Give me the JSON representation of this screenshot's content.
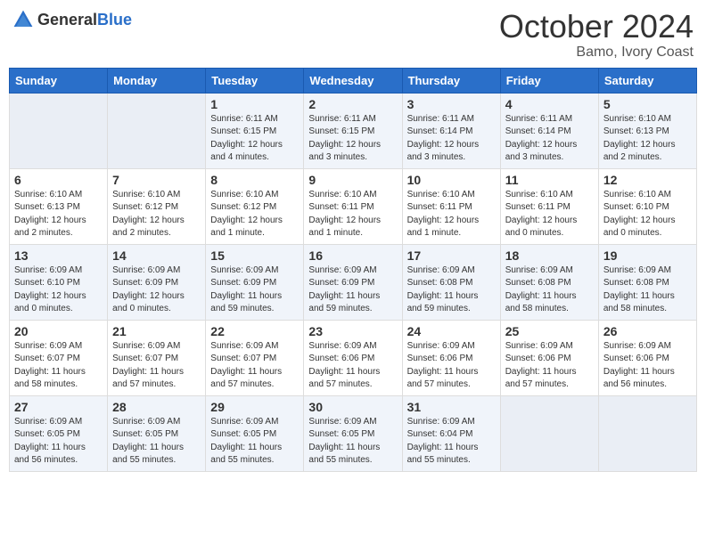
{
  "header": {
    "logo_general": "General",
    "logo_blue": "Blue",
    "month": "October 2024",
    "location": "Bamo, Ivory Coast"
  },
  "weekdays": [
    "Sunday",
    "Monday",
    "Tuesday",
    "Wednesday",
    "Thursday",
    "Friday",
    "Saturday"
  ],
  "weeks": [
    [
      {
        "day": "",
        "info": ""
      },
      {
        "day": "",
        "info": ""
      },
      {
        "day": "1",
        "info": "Sunrise: 6:11 AM\nSunset: 6:15 PM\nDaylight: 12 hours and 4 minutes."
      },
      {
        "day": "2",
        "info": "Sunrise: 6:11 AM\nSunset: 6:15 PM\nDaylight: 12 hours and 3 minutes."
      },
      {
        "day": "3",
        "info": "Sunrise: 6:11 AM\nSunset: 6:14 PM\nDaylight: 12 hours and 3 minutes."
      },
      {
        "day": "4",
        "info": "Sunrise: 6:11 AM\nSunset: 6:14 PM\nDaylight: 12 hours and 3 minutes."
      },
      {
        "day": "5",
        "info": "Sunrise: 6:10 AM\nSunset: 6:13 PM\nDaylight: 12 hours and 2 minutes."
      }
    ],
    [
      {
        "day": "6",
        "info": "Sunrise: 6:10 AM\nSunset: 6:13 PM\nDaylight: 12 hours and 2 minutes."
      },
      {
        "day": "7",
        "info": "Sunrise: 6:10 AM\nSunset: 6:12 PM\nDaylight: 12 hours and 2 minutes."
      },
      {
        "day": "8",
        "info": "Sunrise: 6:10 AM\nSunset: 6:12 PM\nDaylight: 12 hours and 1 minute."
      },
      {
        "day": "9",
        "info": "Sunrise: 6:10 AM\nSunset: 6:11 PM\nDaylight: 12 hours and 1 minute."
      },
      {
        "day": "10",
        "info": "Sunrise: 6:10 AM\nSunset: 6:11 PM\nDaylight: 12 hours and 1 minute."
      },
      {
        "day": "11",
        "info": "Sunrise: 6:10 AM\nSunset: 6:11 PM\nDaylight: 12 hours and 0 minutes."
      },
      {
        "day": "12",
        "info": "Sunrise: 6:10 AM\nSunset: 6:10 PM\nDaylight: 12 hours and 0 minutes."
      }
    ],
    [
      {
        "day": "13",
        "info": "Sunrise: 6:09 AM\nSunset: 6:10 PM\nDaylight: 12 hours and 0 minutes."
      },
      {
        "day": "14",
        "info": "Sunrise: 6:09 AM\nSunset: 6:09 PM\nDaylight: 12 hours and 0 minutes."
      },
      {
        "day": "15",
        "info": "Sunrise: 6:09 AM\nSunset: 6:09 PM\nDaylight: 11 hours and 59 minutes."
      },
      {
        "day": "16",
        "info": "Sunrise: 6:09 AM\nSunset: 6:09 PM\nDaylight: 11 hours and 59 minutes."
      },
      {
        "day": "17",
        "info": "Sunrise: 6:09 AM\nSunset: 6:08 PM\nDaylight: 11 hours and 59 minutes."
      },
      {
        "day": "18",
        "info": "Sunrise: 6:09 AM\nSunset: 6:08 PM\nDaylight: 11 hours and 58 minutes."
      },
      {
        "day": "19",
        "info": "Sunrise: 6:09 AM\nSunset: 6:08 PM\nDaylight: 11 hours and 58 minutes."
      }
    ],
    [
      {
        "day": "20",
        "info": "Sunrise: 6:09 AM\nSunset: 6:07 PM\nDaylight: 11 hours and 58 minutes."
      },
      {
        "day": "21",
        "info": "Sunrise: 6:09 AM\nSunset: 6:07 PM\nDaylight: 11 hours and 57 minutes."
      },
      {
        "day": "22",
        "info": "Sunrise: 6:09 AM\nSunset: 6:07 PM\nDaylight: 11 hours and 57 minutes."
      },
      {
        "day": "23",
        "info": "Sunrise: 6:09 AM\nSunset: 6:06 PM\nDaylight: 11 hours and 57 minutes."
      },
      {
        "day": "24",
        "info": "Sunrise: 6:09 AM\nSunset: 6:06 PM\nDaylight: 11 hours and 57 minutes."
      },
      {
        "day": "25",
        "info": "Sunrise: 6:09 AM\nSunset: 6:06 PM\nDaylight: 11 hours and 57 minutes."
      },
      {
        "day": "26",
        "info": "Sunrise: 6:09 AM\nSunset: 6:06 PM\nDaylight: 11 hours and 56 minutes."
      }
    ],
    [
      {
        "day": "27",
        "info": "Sunrise: 6:09 AM\nSunset: 6:05 PM\nDaylight: 11 hours and 56 minutes."
      },
      {
        "day": "28",
        "info": "Sunrise: 6:09 AM\nSunset: 6:05 PM\nDaylight: 11 hours and 55 minutes."
      },
      {
        "day": "29",
        "info": "Sunrise: 6:09 AM\nSunset: 6:05 PM\nDaylight: 11 hours and 55 minutes."
      },
      {
        "day": "30",
        "info": "Sunrise: 6:09 AM\nSunset: 6:05 PM\nDaylight: 11 hours and 55 minutes."
      },
      {
        "day": "31",
        "info": "Sunrise: 6:09 AM\nSunset: 6:04 PM\nDaylight: 11 hours and 55 minutes."
      },
      {
        "day": "",
        "info": ""
      },
      {
        "day": "",
        "info": ""
      }
    ]
  ]
}
